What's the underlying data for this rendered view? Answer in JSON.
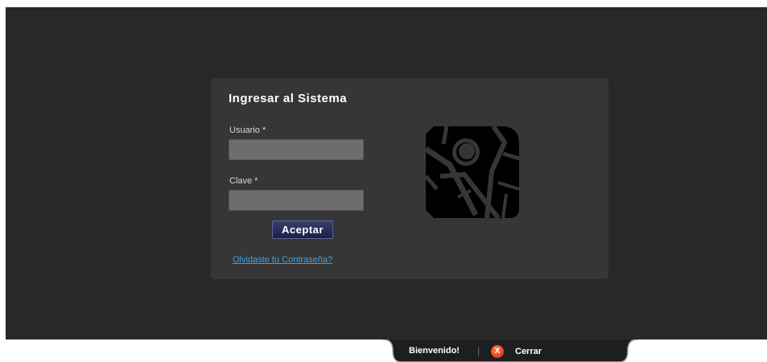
{
  "login": {
    "title": "Ingresar al Sistema",
    "username_label": "Usuario *",
    "username_value": "",
    "password_label": "Clave *",
    "password_value": "",
    "submit_label": "Aceptar",
    "forgot_link": "Olvidaste tu Contraseña?"
  },
  "logo": {
    "icon": "map-logo-icon"
  },
  "footer": {
    "welcome": "Bienvenido!",
    "separator": "|",
    "close_icon": "X",
    "close_label": "Cerrar"
  },
  "colors": {
    "background": "#282828",
    "panel": "#363636",
    "input": "#6d6d6d",
    "button": "#1f2450",
    "link": "#3fa0e8",
    "close_icon": "#e0421a"
  }
}
